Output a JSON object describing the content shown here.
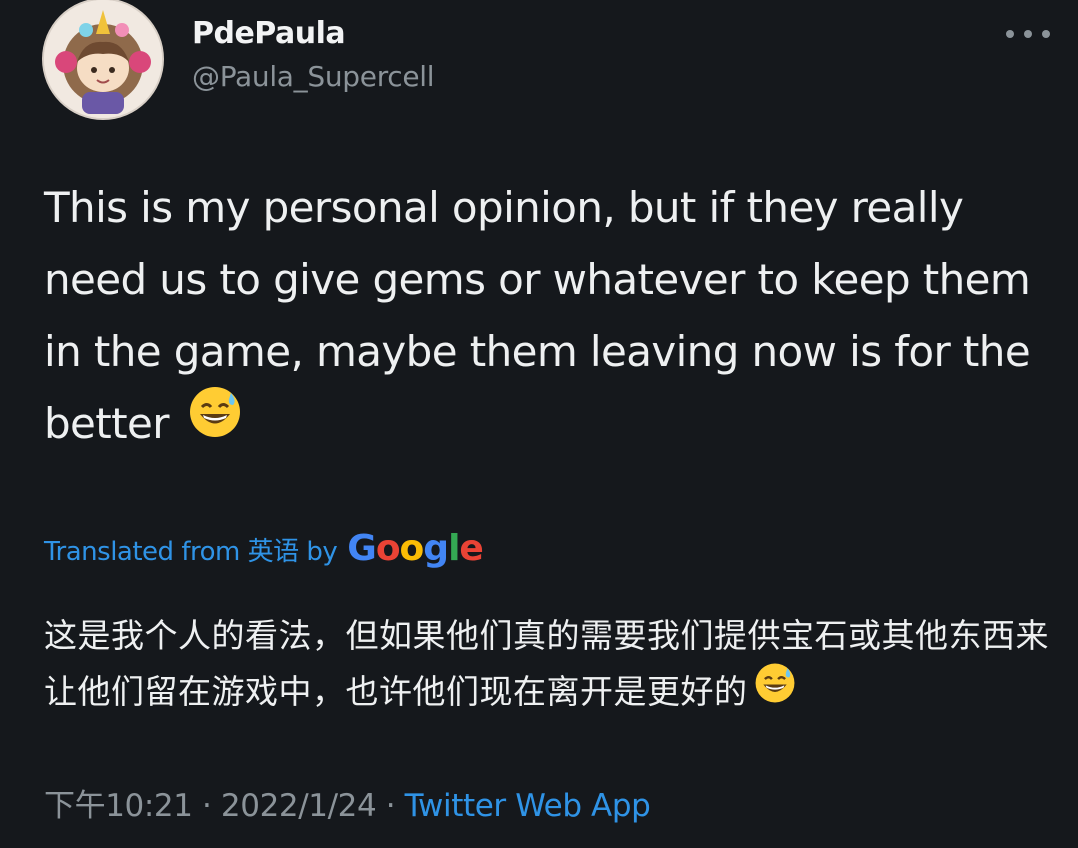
{
  "author": {
    "display_name": "PdePaula",
    "handle": "@Paula_Supercell"
  },
  "tweet": {
    "text": "This is my personal opinion, but if they really need us to give gems or whatever to keep them in the game, maybe them leaving now is for the better",
    "emoji": "grinning-face-with-sweat-icon"
  },
  "translation": {
    "label": "Translated from 英语 by",
    "provider": "Google",
    "text": "这是我个人的看法，但如果他们真的需要我们提供宝石或其他东西来让他们留在游戏中，也许他们现在离开是更好的"
  },
  "meta": {
    "time": "下午10:21",
    "separator1": " · ",
    "date": "2022/1/24",
    "separator2": " · ",
    "source": "Twitter Web App"
  },
  "colors": {
    "background": "#15181c",
    "link": "#2f93e6",
    "secondary_text": "#8b9399"
  },
  "icons": [
    "avatar",
    "more-icon",
    "grinning-face-with-sweat-icon"
  ]
}
